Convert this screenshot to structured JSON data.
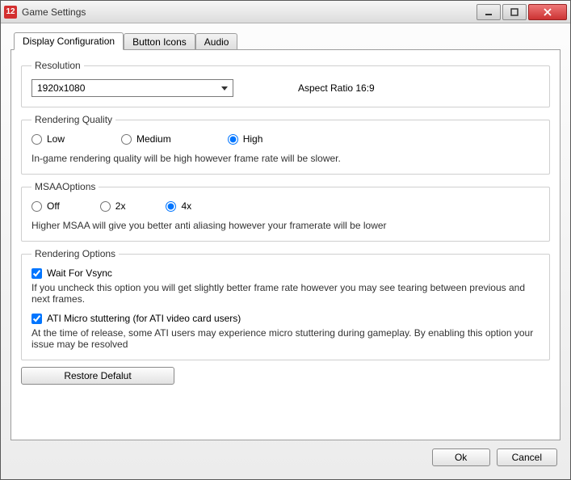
{
  "window": {
    "title": "Game Settings",
    "icon_text": "12"
  },
  "tabs": {
    "display": "Display Configuration",
    "buttons": "Button Icons",
    "audio": "Audio"
  },
  "resolution": {
    "legend": "Resolution",
    "selected": "1920x1080",
    "aspect": "Aspect Ratio 16:9"
  },
  "quality": {
    "legend": "Rendering Quality",
    "low": "Low",
    "medium": "Medium",
    "high": "High",
    "desc": "In-game rendering quality will be high however frame rate will be slower."
  },
  "msaa": {
    "legend": "MSAAOptions",
    "off": "Off",
    "x2": "2x",
    "x4": "4x",
    "desc": "Higher MSAA will give you better anti aliasing however your framerate will be lower"
  },
  "rendering": {
    "legend": "Rendering Options",
    "vsync_label": "Wait For Vsync",
    "vsync_desc": "If you uncheck this option you will get slightly better frame rate however you may see tearing between previous and next frames.",
    "ati_label": "ATI Micro stuttering (for ATI video card users)",
    "ati_desc": "At the time of release, some ATI users may experience micro stuttering during gameplay. By enabling this option your issue may be resolved"
  },
  "buttons": {
    "restore": "Restore Defalut",
    "ok": "Ok",
    "cancel": "Cancel"
  }
}
